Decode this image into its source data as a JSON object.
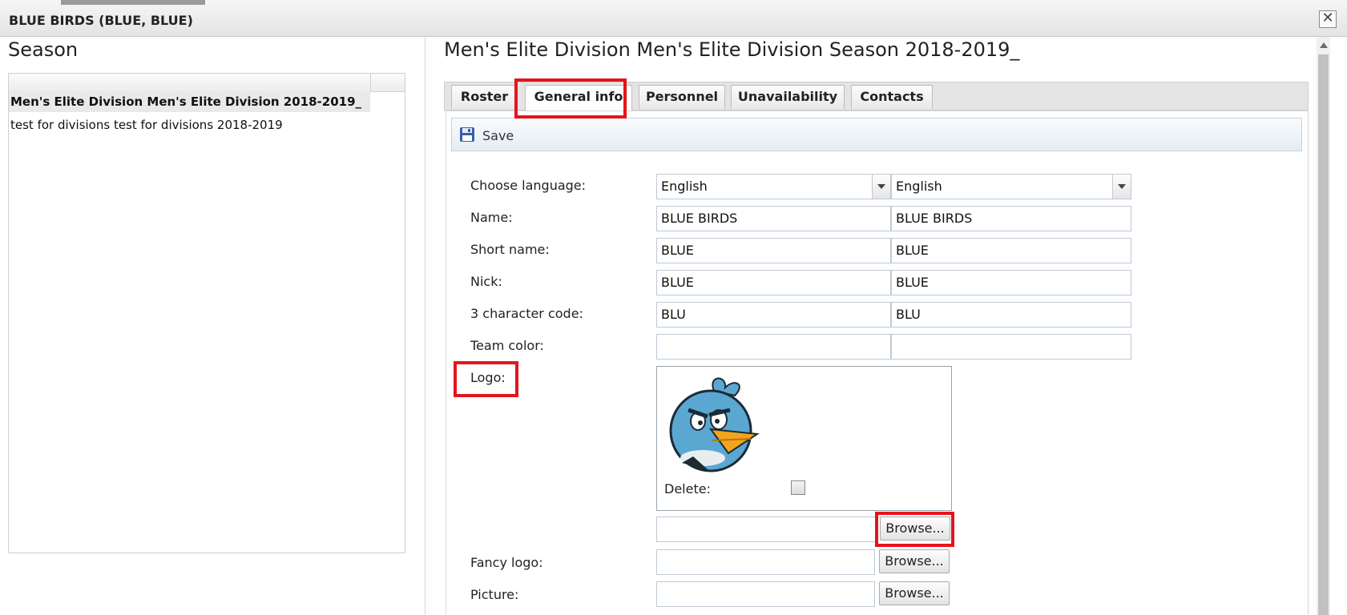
{
  "window": {
    "title": "BLUE BIRDS (BLUE, BLUE)",
    "close": "✕"
  },
  "season": {
    "heading": "Season",
    "rows": [
      "Men's Elite Division Men's Elite Division 2018-2019_",
      "test for divisions test for divisions 2018-2019"
    ]
  },
  "main": {
    "title": "Men's Elite Division Men's Elite Division Season 2018-2019_",
    "tabs": [
      "Roster",
      "General info",
      "Personnel",
      "Unavailability",
      "Contacts"
    ],
    "active_tab": "General info",
    "toolbar": {
      "save_label": "Save"
    }
  },
  "form": {
    "choose_language": {
      "label": "Choose language:",
      "value1": "English",
      "value2": "English"
    },
    "name": {
      "label": "Name:",
      "value1": "BLUE BIRDS",
      "value2": "BLUE BIRDS"
    },
    "short_name": {
      "label": "Short name:",
      "value1": "BLUE",
      "value2": "BLUE"
    },
    "nick": {
      "label": "Nick:",
      "value1": "BLUE",
      "value2": "BLUE"
    },
    "code": {
      "label": "3 character code:",
      "value1": "BLU",
      "value2": "BLU"
    },
    "team_color": {
      "label": "Team color:",
      "value1": "",
      "value2": ""
    },
    "logo": {
      "label": "Logo:",
      "delete_label": "Delete:",
      "browse": "Browse..."
    },
    "fancy_logo": {
      "label": "Fancy logo:",
      "browse": "Browse..."
    },
    "picture": {
      "label": "Picture:",
      "browse": "Browse..."
    }
  },
  "colors": {
    "highlight": "#e5141c",
    "bird_blue": "#5aa8d2",
    "beak": "#f2a51c"
  },
  "icons": {
    "save": "floppy-disk-icon",
    "close": "close-icon",
    "dropdown": "chevron-down-icon"
  }
}
